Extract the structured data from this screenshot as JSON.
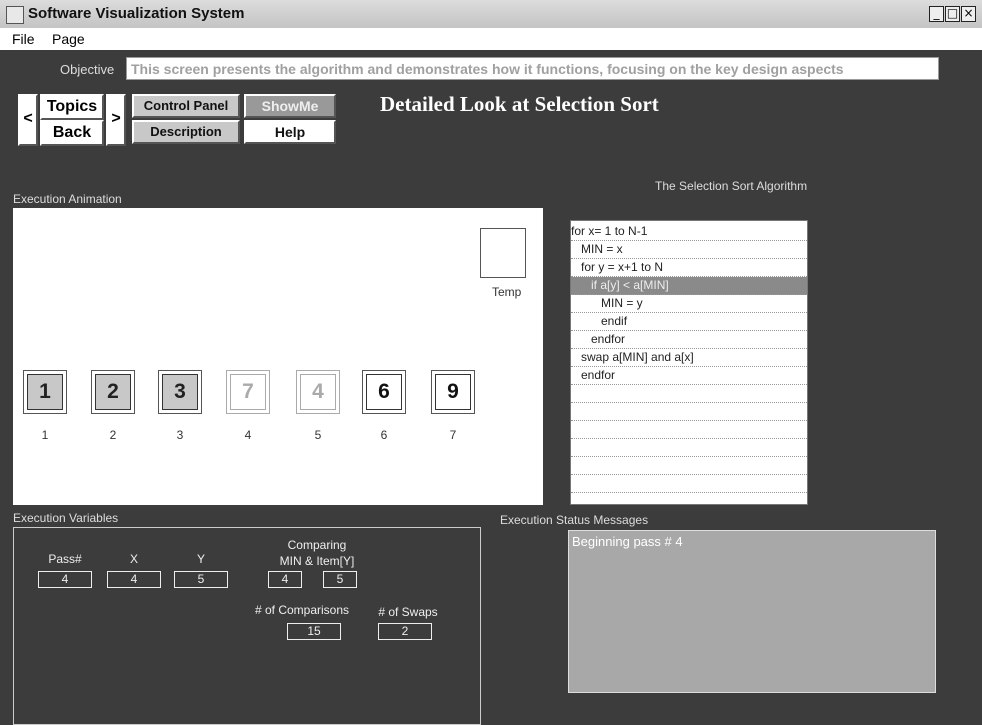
{
  "window": {
    "title": "Software Visualization System",
    "minimize": "_",
    "maximize": "□",
    "close": "×"
  },
  "menu": {
    "file": "File",
    "page": "Page"
  },
  "objective": {
    "label": "Objective",
    "text": "This screen presents the algorithm and demonstrates how it functions, focusing on the key design aspects"
  },
  "nav": {
    "prev": "<",
    "next": ">",
    "topics": "Topics",
    "back": "Back"
  },
  "tabs": {
    "control_panel": "Control Panel",
    "description": "Description",
    "show_me": "ShowMe",
    "help": "Help"
  },
  "page_title": "Detailed Look at Selection Sort",
  "animation": {
    "label": "Execution Animation",
    "temp_label": "Temp",
    "cells": [
      {
        "value": "1",
        "index": "1",
        "state": "sorted"
      },
      {
        "value": "2",
        "index": "2",
        "state": "sorted"
      },
      {
        "value": "3",
        "index": "3",
        "state": "sorted"
      },
      {
        "value": "7",
        "index": "4",
        "state": "dim"
      },
      {
        "value": "4",
        "index": "5",
        "state": "dim"
      },
      {
        "value": "6",
        "index": "6",
        "state": "unsorted"
      },
      {
        "value": "9",
        "index": "7",
        "state": "unsorted"
      }
    ]
  },
  "algorithm": {
    "title": "The Selection Sort Algorithm",
    "lines": [
      "for x= 1 to N-1",
      "   MIN = x",
      "   for y = x+1 to N",
      "      if a[y] < a[MIN]",
      "         MIN = y",
      "         endif",
      "      endfor",
      "   swap a[MIN] and a[x]",
      "   endfor",
      "",
      "",
      "",
      "",
      "",
      ""
    ],
    "highlight_line": 3
  },
  "variables": {
    "label": "Execution Variables",
    "pass_label": "Pass#",
    "pass": "4",
    "x_label": "X",
    "x": "4",
    "y_label": "Y",
    "y": "5",
    "comparing_label": "Comparing",
    "comparing_sub": "MIN & Item[Y]",
    "min_value": "4",
    "item_value": "5",
    "comparisons_label": "# of Comparisons",
    "comparisons": "15",
    "swaps_label": "# of Swaps",
    "swaps": "2"
  },
  "status": {
    "label": "Execution Status Messages",
    "message": "Beginning pass # 4"
  }
}
